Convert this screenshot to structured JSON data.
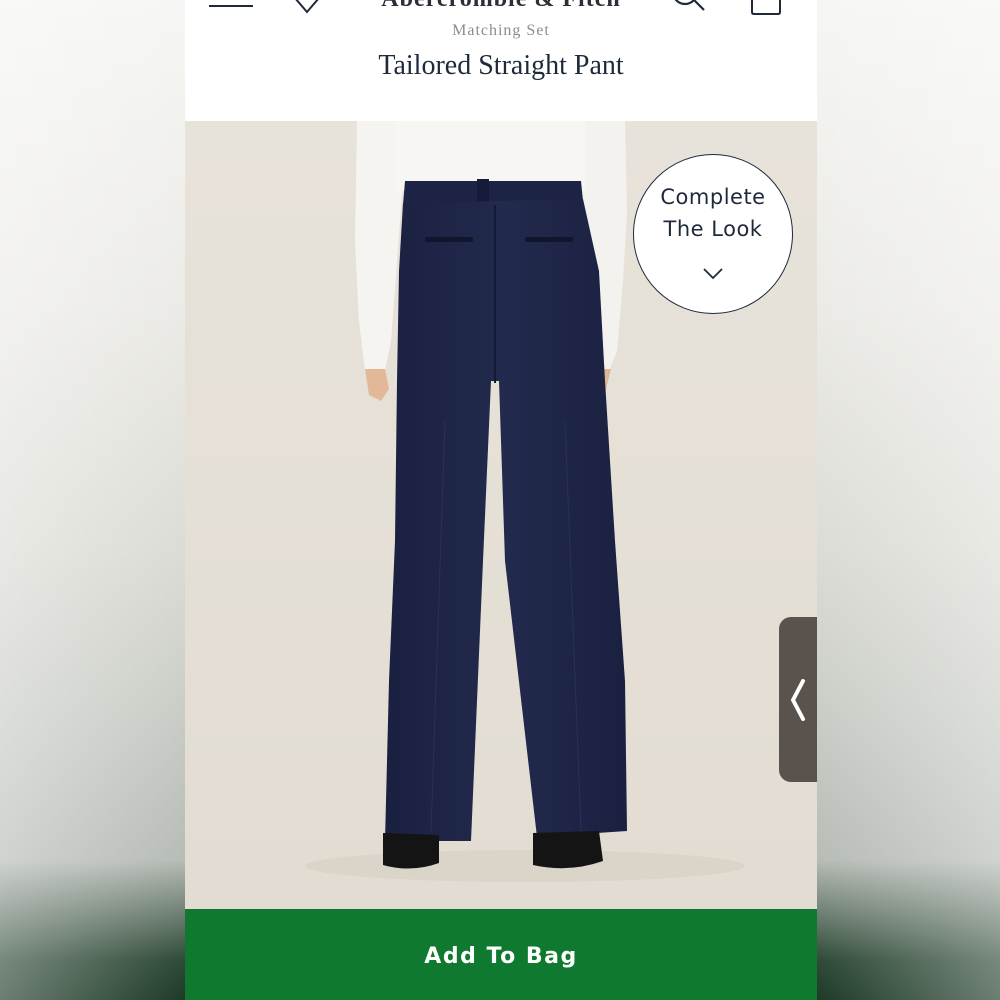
{
  "header": {
    "brand": "Abercrombie & Fitch",
    "collection_label": "Matching Set",
    "product_title": "Tailored Straight Pant",
    "icons": [
      "menu-icon",
      "heart-icon",
      "search-icon",
      "bag-icon"
    ]
  },
  "image": {
    "alt": "Back view of model wearing navy tailored straight pants with white top"
  },
  "complete_look": {
    "line1": "Complete",
    "line2": "The Look",
    "icon": "chevron-down-icon"
  },
  "side_tab": {
    "icon": "chevron-left-icon"
  },
  "actions": {
    "add_to_bag": "Add To Bag"
  },
  "colors": {
    "primary_text": "#1e2a3a",
    "cta_green": "#0f7a2f",
    "pant_navy": "#1f2647",
    "image_bg": "#e8e3da",
    "side_tab": "#5a524d"
  }
}
